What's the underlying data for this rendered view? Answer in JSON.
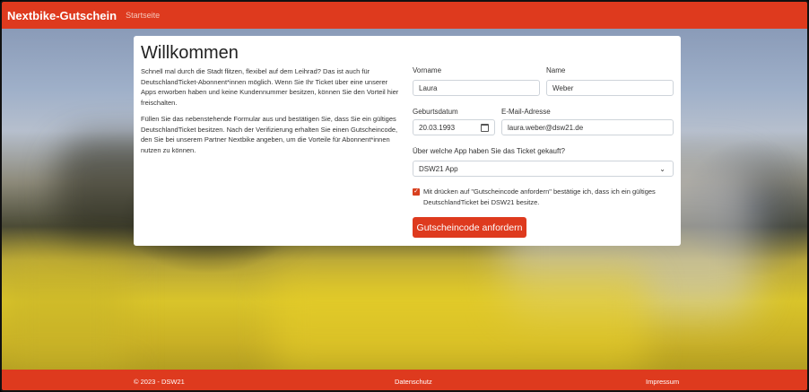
{
  "nav": {
    "brand": "Nextbike-Gutschein",
    "link": "Startseite"
  },
  "card": {
    "title": "Willkommen",
    "intro1": "Schnell mal durch die Stadt flitzen, flexibel auf dem Leihrad? Das ist auch für DeutschlandTicket-Abonnent*innen möglich. Wenn Sie Ihr Ticket über eine unserer Apps erworben haben und keine Kundennummer besitzen, können Sie den Vorteil hier freischalten.",
    "intro2": "Füllen Sie das nebenstehende Formular aus und bestätigen Sie, dass Sie ein gültiges DeutschlandTicket besitzen. Nach der Verifizierung erhalten Sie einen Gutscheincode, den Sie bei unserem Partner Nextbike angeben, um die Vorteile für Abonnent*innen nutzen zu können."
  },
  "form": {
    "firstname_label": "Vorname",
    "firstname_value": "Laura",
    "lastname_label": "Name",
    "lastname_value": "Weber",
    "birthdate_label": "Geburtsdatum",
    "birthdate_value": "20.03.1993",
    "email_label": "E-Mail-Adresse",
    "email_value": "laura.weber@dsw21.de",
    "app_label": "Über welche App haben Sie das Ticket gekauft?",
    "app_value": "DSW21 App",
    "checkbox_label": "Mit drücken auf \"Gutscheincode anfordern\" bestätige ich, dass ich ein gültiges DeutschlandTicket bei DSW21 besitze.",
    "submit_label": "Gutscheincode anfordern"
  },
  "footer": {
    "copyright": "© 2023 - DSW21",
    "privacy": "Datenschutz",
    "imprint": "Impressum"
  },
  "colors": {
    "brand": "#de3a1e",
    "icons": {
      "calendar": "calendar-icon",
      "dropdown": "chevron-down-icon",
      "check": "check-icon"
    }
  }
}
